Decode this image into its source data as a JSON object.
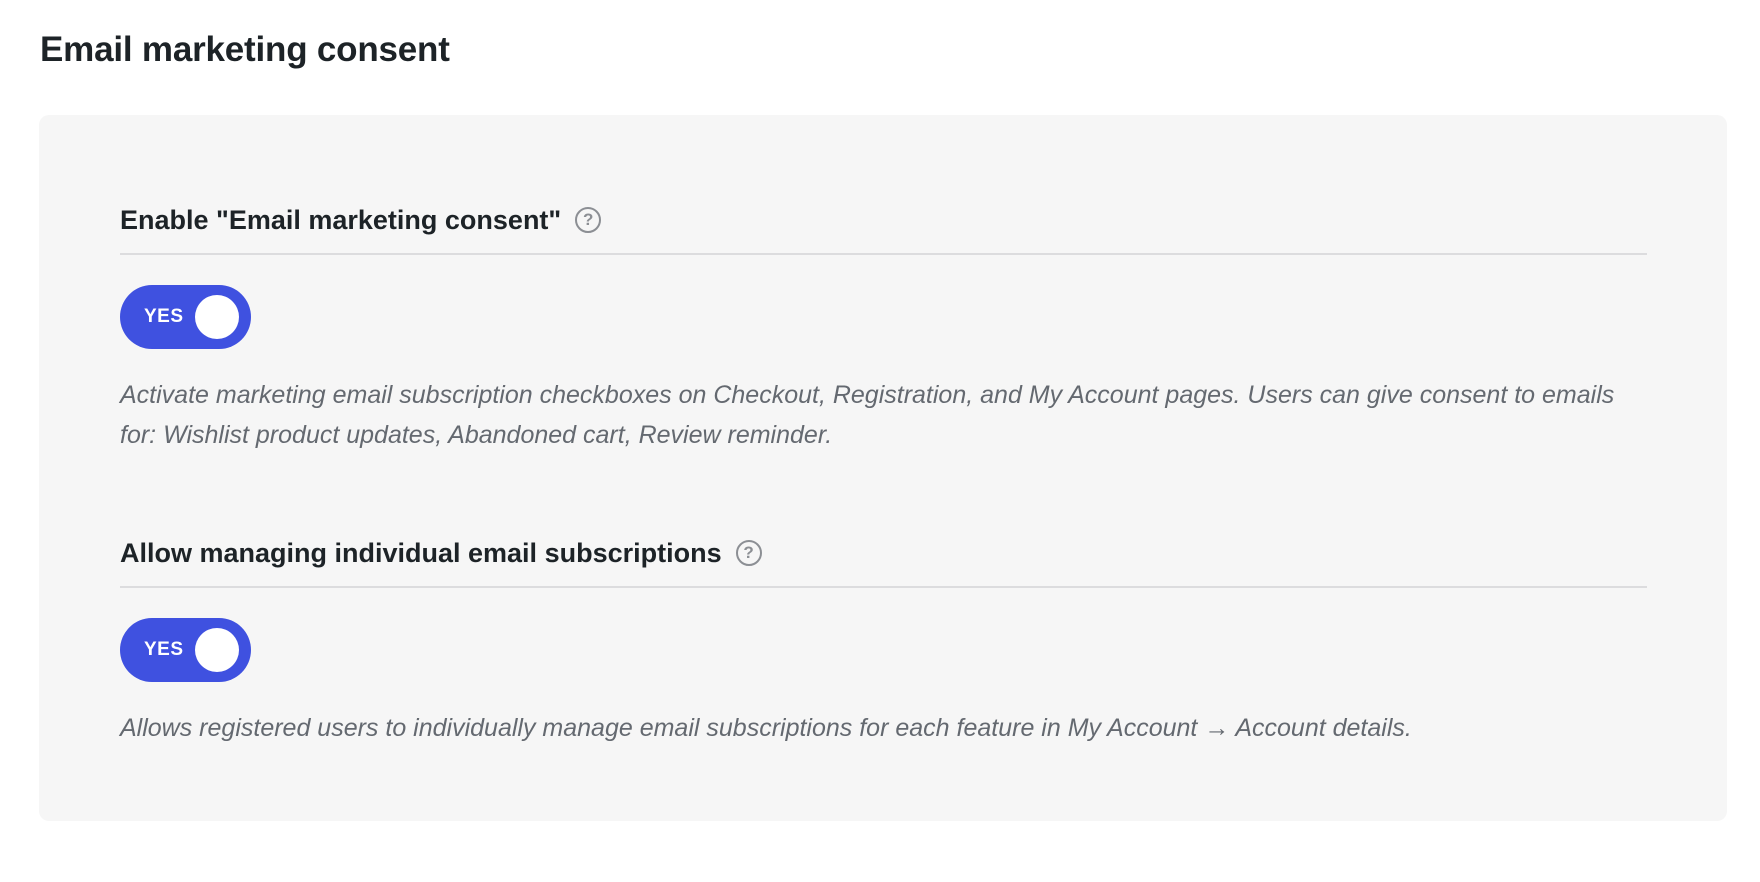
{
  "page": {
    "title": "Email marketing consent"
  },
  "colors": {
    "toggle_on": "#3f51e0",
    "panel_bg": "#f6f6f6",
    "description_text": "#646970"
  },
  "settings": [
    {
      "label": "Enable \"Email marketing consent\"",
      "help_icon": "question-circle-icon",
      "help_symbol": "?",
      "toggle_label": "YES",
      "toggle_state": "on",
      "description": "Activate marketing email subscription checkboxes on Checkout, Registration, and My Account pages. Users can give consent to emails for: Wishlist product updates, Abandoned cart, Review reminder."
    },
    {
      "label": "Allow managing individual email subscriptions",
      "help_icon": "question-circle-icon",
      "help_symbol": "?",
      "toggle_label": "YES",
      "toggle_state": "on",
      "description": "Allows registered users to individually manage email subscriptions for each feature in My Account → Account details."
    }
  ]
}
